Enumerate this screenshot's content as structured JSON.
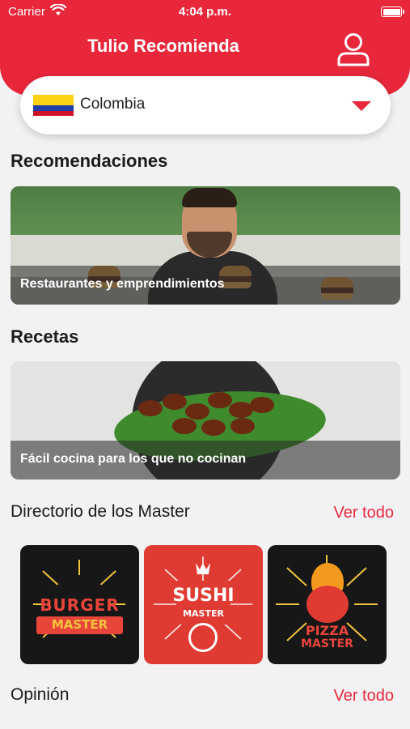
{
  "status_bar": {
    "carrier": "Carrier",
    "time": "4:04 p.m."
  },
  "header": {
    "title": "Tulio Recomienda"
  },
  "country_selector": {
    "value": "Colombia"
  },
  "sections": {
    "recommendations": {
      "title": "Recomendaciones",
      "caption": "Restaurantes y emprendimientos"
    },
    "recipes": {
      "title": "Recetas",
      "caption": "Fácil cocina para los que no cocinan"
    },
    "directory": {
      "title": "Directorio de los Master",
      "see_all": "Ver todo",
      "cards": [
        {
          "line1": "BURGER",
          "line2": "MASTER"
        },
        {
          "line1": "SUSHI",
          "line2": "MASTER"
        },
        {
          "line1": "PIZZA",
          "line2": "MASTER"
        }
      ]
    },
    "opinion": {
      "title": "Opinión",
      "see_all": "Ver todo"
    }
  },
  "colors": {
    "brand_red": "#e8273b",
    "background": "#f2f2f4"
  },
  "icons": {
    "wifi": "wifi-icon",
    "battery": "battery-icon",
    "profile": "user-profile-icon",
    "dropdown": "caret-down-icon"
  }
}
